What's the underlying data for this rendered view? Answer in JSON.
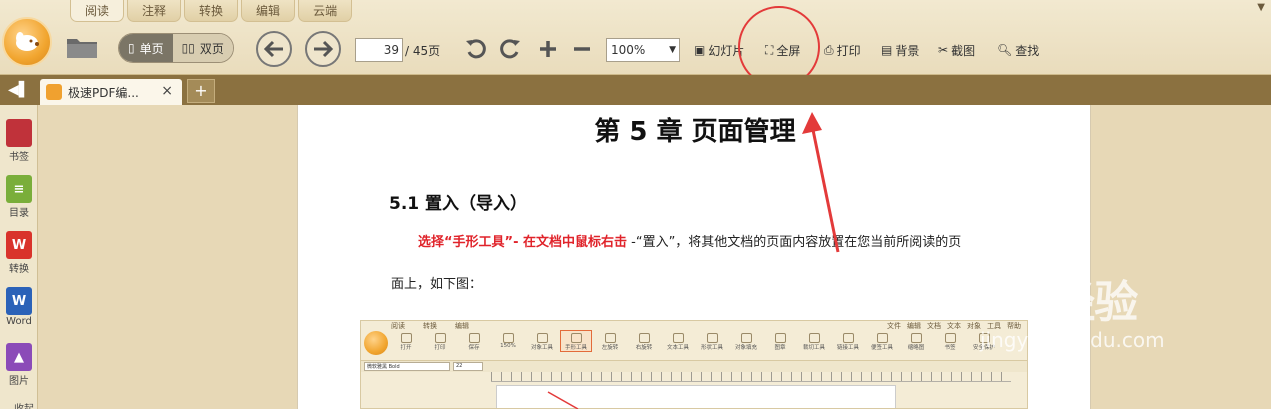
{
  "menu_tabs": [
    "阅读",
    "注释",
    "转换",
    "编辑",
    "云端"
  ],
  "toolbar": {
    "view_single": "单页",
    "view_double": "双页",
    "page_current": "39",
    "page_total": "/ 45页",
    "zoom": "100%",
    "slideshow": "幻灯片",
    "fullscreen": "全屏",
    "print": "打印",
    "background": "背景",
    "screenshot": "截图",
    "find": "查找"
  },
  "tab": {
    "title": "极速PDF编...",
    "close": "×",
    "new": "+"
  },
  "sidebar": {
    "items": [
      {
        "label": "书签",
        "icon": "bookmark-icon",
        "color": "#c0323a",
        "glyph": ""
      },
      {
        "label": "目录",
        "icon": "toc-icon",
        "color": "#7aae3a",
        "glyph": ""
      },
      {
        "label": "转换",
        "icon": "convert-icon",
        "color": "#d9332b",
        "glyph": ""
      },
      {
        "label": "Word",
        "icon": "word-icon",
        "color": "#2b62b8",
        "glyph": "W"
      },
      {
        "label": "图片",
        "icon": "image-icon",
        "color": "#8b4bb8",
        "glyph": ""
      },
      {
        "label": "收起",
        "icon": "collapse-icon",
        "color": "",
        "glyph": ""
      }
    ]
  },
  "document": {
    "chapter_title": "第 5 章  页面管理",
    "section_title": "5.1 置入（导入）",
    "instruction_red": "选择“手形工具”- 在文档中鼠标右击",
    "instruction_rest": " -“置入”，将其他文档的页面内容放置在您当前所阅读的页",
    "line2": "面上，如下图："
  },
  "embedded": {
    "tabs": [
      "阅读",
      "转换",
      "编辑"
    ],
    "right_menu": [
      "文件",
      "编辑",
      "文档",
      "文本",
      "对象",
      "工具",
      "帮助"
    ],
    "tools": [
      "打开",
      "打印",
      "保存",
      "150%",
      "对象工具",
      "手形工具",
      "左旋转",
      "右旋转",
      "文本工具",
      "形状工具",
      "对象填充",
      "图章",
      "裁切工具",
      "链接工具",
      "便签工具",
      "缩略图",
      "书签",
      "安全保护"
    ],
    "font": "微软雅黑 Bold",
    "font_size": "22"
  },
  "watermark": {
    "brand": "Bai经验",
    "url": "jingyan.baidu.com"
  },
  "colors": {
    "accent_red": "#e0232a",
    "tabbar": "#8b7140"
  }
}
